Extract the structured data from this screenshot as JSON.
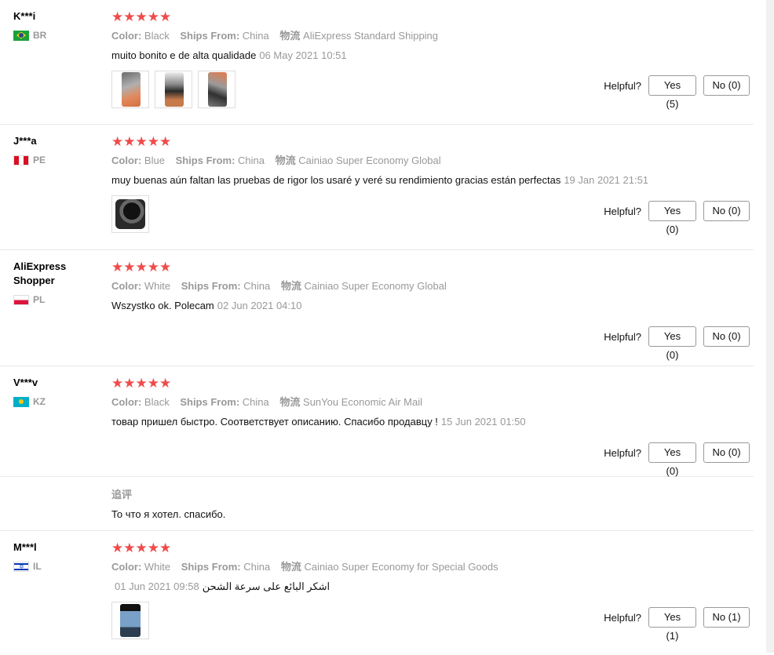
{
  "reviews": [
    {
      "user": "K***i",
      "country": "BR",
      "stars": "★★★★★",
      "color_label": "Color:",
      "color": "Black",
      "ships_label": "Ships From:",
      "ships": "China",
      "logistics_label": "物流",
      "logistics": "AliExpress Standard Shipping",
      "text": "muito bonito e de alta qualidade",
      "date": "06 May 2021 10:51",
      "helpful_label": "Helpful?",
      "yes": "Yes (5)",
      "no": "No (0)"
    },
    {
      "user": "J***a",
      "country": "PE",
      "stars": "★★★★★",
      "color_label": "Color:",
      "color": "Blue",
      "ships_label": "Ships From:",
      "ships": "China",
      "logistics_label": "物流",
      "logistics": "Cainiao Super Economy Global",
      "text": "muy buenas aún faltan las pruebas de rigor los usaré y veré su rendimiento gracias están perfectas",
      "date": "19 Jan 2021 21:51",
      "helpful_label": "Helpful?",
      "yes": "Yes (0)",
      "no": "No (0)"
    },
    {
      "user": "AliExpress Shopper",
      "country": "PL",
      "stars": "★★★★★",
      "color_label": "Color:",
      "color": "White",
      "ships_label": "Ships From:",
      "ships": "China",
      "logistics_label": "物流",
      "logistics": "Cainiao Super Economy Global",
      "text": "Wszystko ok. Polecam",
      "date": "02 Jun 2021 04:10",
      "helpful_label": "Helpful?",
      "yes": "Yes (0)",
      "no": "No (0)"
    },
    {
      "user": "V***v",
      "country": "KZ",
      "stars": "★★★★★",
      "color_label": "Color:",
      "color": "Black",
      "ships_label": "Ships From:",
      "ships": "China",
      "logistics_label": "物流",
      "logistics": "SunYou Economic Air Mail",
      "text": "товар пришел быстро. Соответствует описанию. Спасибо продавцу !",
      "date": "15 Jun 2021 01:50",
      "helpful_label": "Helpful?",
      "yes": "Yes (0)",
      "no": "No (0)",
      "followup_title": "追评",
      "followup_text": "То что я хотел. спасибо."
    },
    {
      "user": "M***l",
      "country": "IL",
      "stars": "★★★★★",
      "color_label": "Color:",
      "color": "White",
      "ships_label": "Ships From:",
      "ships": "China",
      "logistics_label": "物流",
      "logistics": "Cainiao Super Economy for Special Goods",
      "text": "اشكر البائع على سرعة الشحن",
      "date": "01 Jun 2021 09:58",
      "helpful_label": "Helpful?",
      "yes": "Yes (1)",
      "no": "No (1)"
    }
  ],
  "colors": {
    "star": "#f04b4b",
    "muted": "#999999",
    "border": "#e8e8e8"
  }
}
